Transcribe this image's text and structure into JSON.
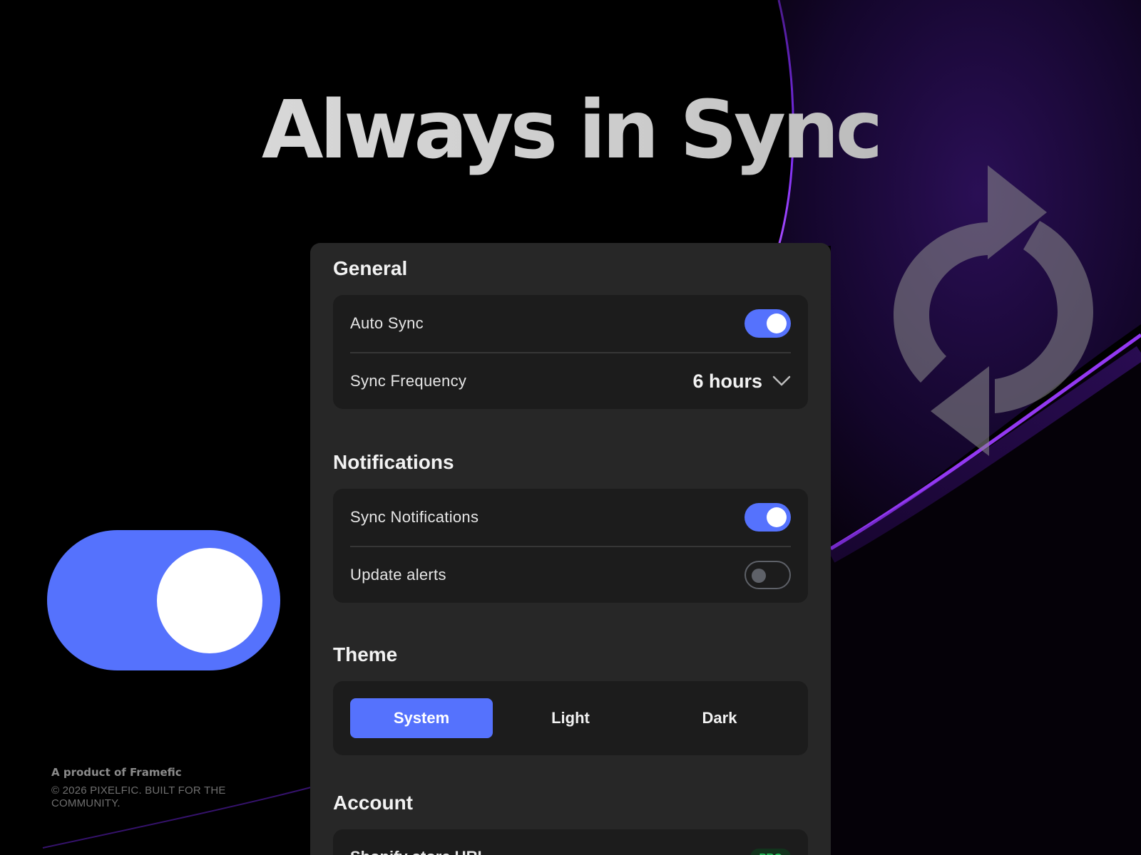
{
  "hero": {
    "title": "Always in Sync"
  },
  "decor": {
    "sync_icon": "sync-arrows-icon",
    "toggle_illustration": "toggle-on"
  },
  "footer": {
    "brand": "A product of Framefic",
    "copyright": "© 2026 PIXELFIC. BUILT FOR THE COMMUNITY."
  },
  "settings": {
    "general": {
      "title": "General",
      "auto_sync": {
        "label": "Auto Sync",
        "enabled": true
      },
      "sync_frequency": {
        "label": "Sync Frequency",
        "value": "6 hours"
      }
    },
    "notifications": {
      "title": "Notifications",
      "sync_notifications": {
        "label": "Sync Notifications",
        "enabled": true
      },
      "update_alerts": {
        "label": "Update alerts",
        "enabled": false
      }
    },
    "theme": {
      "title": "Theme",
      "options": [
        "System",
        "Light",
        "Dark"
      ],
      "selected": "System"
    },
    "account": {
      "title": "Account",
      "store_url": {
        "label": "Shopify store URL",
        "badge": "PRO"
      }
    }
  },
  "colors": {
    "accent": "#5572fd",
    "panel": "#272727",
    "group": "#1c1c1c",
    "purple_glow": "#8b2cf5",
    "pro_green": "#24c35b"
  }
}
